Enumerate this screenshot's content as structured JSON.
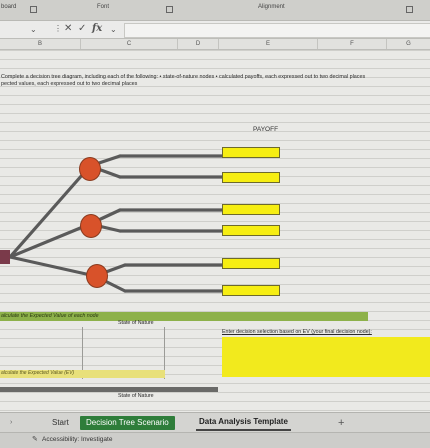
{
  "ribbon": {
    "clipboard": "board",
    "font": "Font",
    "alignment": "Alignment"
  },
  "formula_bar": {
    "fx": "fx",
    "cancel": "✕",
    "enter": "✓"
  },
  "columns": [
    "B",
    "C",
    "D",
    "E",
    "F",
    "G"
  ],
  "sheet": {
    "instruction_1": "Complete a decision tree diagram, including each of the following: • state-of-nature nodes • calculated payoffs, each expressed out to two decimal places",
    "instruction_2": "pected values, each expressed out to two decimal places",
    "payoff_label": "PAYOFF",
    "ev_header": "alculate the Expected Value of each node",
    "state_of_nature_1": "State of Nature",
    "decision_prompt": "Enter decision selection based on EV (your final decision node):",
    "ev_header_2": "alculate the Expected Value (EV)",
    "state_of_nature_2": "State of Nature"
  },
  "tabs": {
    "start": "Start",
    "scenario": "Decision Tree Scenario",
    "template": "Data Analysis Template",
    "add": "+"
  },
  "status": {
    "accessibility": "Accessibility: Investigate"
  },
  "colors": {
    "node": "#d8522a",
    "payoff_box": "#f6ee12",
    "branch": "#5a5a5a",
    "green_bar": "#8db14a",
    "decision_root": "#7a3a4a",
    "active_tab": "#2e7d3a"
  }
}
